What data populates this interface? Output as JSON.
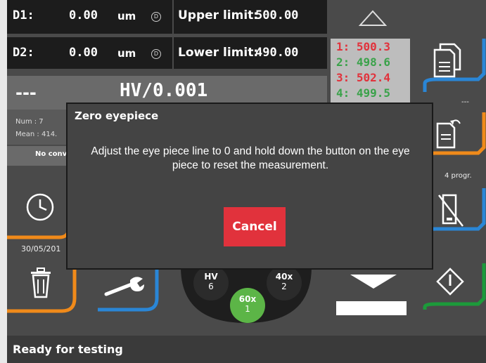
{
  "measure": {
    "d1_label": "D1:",
    "d1_value": "0.00",
    "d1_unit": "um",
    "d2_label": "D2:",
    "d2_value": "0.00",
    "d2_unit": "um",
    "d_icon": "D",
    "upper_label": "Upper limit:",
    "upper_value": "500.00",
    "lower_label": "Lower limit:",
    "lower_value": "490.00"
  },
  "result": {
    "value": "---",
    "scale": "HV/0.001"
  },
  "stats": {
    "num": "Num : 7",
    "mean": "Mean : 414.",
    "conversion": "No conv"
  },
  "history": [
    {
      "text": "1: 500.3",
      "color": "#e1323c"
    },
    {
      "text": "2: 498.6",
      "color": "#3aa24a"
    },
    {
      "text": "3: 502.4",
      "color": "#e1323c"
    },
    {
      "text": "4: 499.5",
      "color": "#3aa24a"
    }
  ],
  "side": {
    "copy_label": "---",
    "programs_label": "4 progr.",
    "date": "30/05/201"
  },
  "objectives": [
    {
      "name": "HV",
      "num": "6"
    },
    {
      "name": "40x",
      "num": "2"
    },
    {
      "name": "60x",
      "num": "1"
    }
  ],
  "dialog": {
    "title": "Zero eyepiece",
    "message": "Adjust the eye piece line to 0 and hold down the button on the eye piece to reset the measurement.",
    "cancel_label": "Cancel"
  },
  "status": {
    "text": "Ready for testing"
  },
  "colors": {
    "accent_blue": "#2a86d6",
    "accent_orange": "#f08a1a",
    "accent_green": "#1c9a3a",
    "cancel_red": "#e1323c"
  },
  "icons": [
    "d-circle-icon",
    "scroll-up-icon",
    "copy-document-icon",
    "document-return-icon",
    "no-usb-icon",
    "clock-icon",
    "trash-icon",
    "wrench-icon",
    "scroll-down-icon",
    "start-diamond-icon"
  ]
}
